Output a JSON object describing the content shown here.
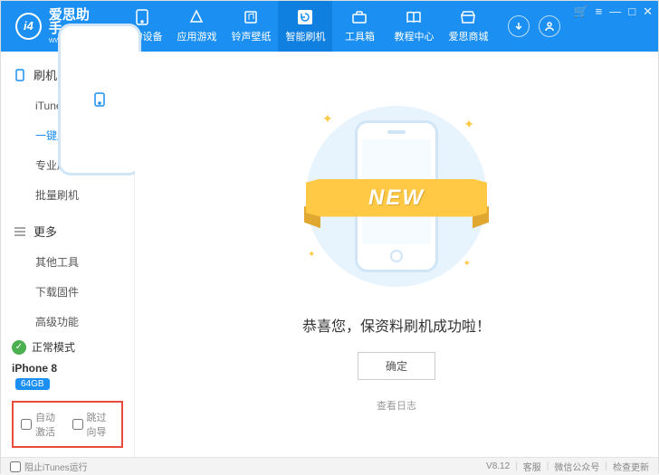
{
  "logo": {
    "badge": "i4",
    "title": "爱思助手",
    "subtitle": "www.i4.cn"
  },
  "nav": [
    {
      "label": "我的设备"
    },
    {
      "label": "应用游戏"
    },
    {
      "label": "铃声壁纸"
    },
    {
      "label": "智能刷机"
    },
    {
      "label": "工具箱"
    },
    {
      "label": "教程中心"
    },
    {
      "label": "爱思商城"
    }
  ],
  "sidebar": {
    "sections": [
      {
        "title": "刷机",
        "items": [
          {
            "label": "iTunes刷机"
          },
          {
            "label": "一键刷机"
          },
          {
            "label": "专业刷机"
          },
          {
            "label": "批量刷机"
          }
        ]
      },
      {
        "title": "更多",
        "items": [
          {
            "label": "其他工具"
          },
          {
            "label": "下载固件"
          },
          {
            "label": "高级功能"
          }
        ]
      }
    ],
    "mode_label": "正常模式",
    "device_name": "iPhone 8",
    "device_storage": "64GB",
    "checkboxes": {
      "auto_activate": "自动激活",
      "skip_guide": "跳过向导"
    }
  },
  "main": {
    "banner_text": "NEW",
    "success_message": "恭喜您，保资料刷机成功啦！",
    "ok_button": "确定",
    "view_log": "查看日志"
  },
  "footer": {
    "prevent_itunes": "阻止iTunes运行",
    "version": "V8.12",
    "support": "客服",
    "wechat": "微信公众号",
    "check_update": "检查更新"
  }
}
